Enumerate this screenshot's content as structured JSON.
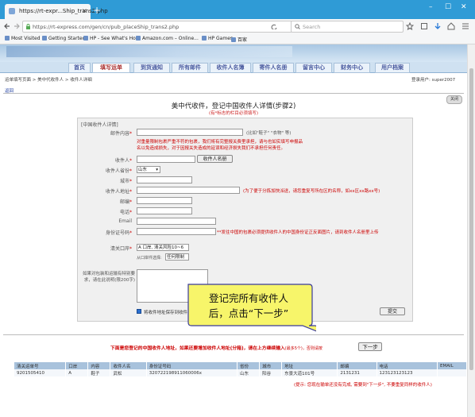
{
  "browser": {
    "tab_title": "https://rt-expr...Ship_trans2.php",
    "tab_close": "×",
    "new_tab": "+",
    "url": "https://rt-express.com/gen/cn/pub_placeShip_trans2.php",
    "search_placeholder": "Search",
    "window_controls": {
      "min": "–",
      "max": "☐",
      "close": "✕"
    },
    "bookmarks": [
      "Most Visited",
      "Getting Started",
      "HP - See What's Hot",
      "Amazon.com – Online...",
      "HP Games",
      "百家"
    ]
  },
  "menu": {
    "items": [
      "首页",
      "填写运单",
      "到货通知",
      "所有邮件",
      "收件人名簿",
      "寄件人名册",
      "留言中心",
      "财务中心",
      "用户档案"
    ],
    "active_index": 1
  },
  "crumb": "运单填写页面 > 美中代收件人 > 收件人详细",
  "user_info": "登录用户: super2007",
  "back_link": "返回",
  "close_btn": "关闭",
  "page": {
    "title": "美中代收件，登记中国收件人详情(步骤2)",
    "subtitle": "(有*标志的栏目必须填写)"
  },
  "form": {
    "section_label": "[中国收件人详情]",
    "content_label": "邮件内容",
    "content_hint": "(比如\"鞋子\" \"衣物\" 等)",
    "warning_line1": "对重量限制包裹严重不符的包裹，我们将有完整报关费里承担，请与也如实填写申报品",
    "warning_line2": "名以免造成损失，对于因报关失造成的延误和经济损失我们不承担任何责任。",
    "recipient_label": "收件人",
    "recipient_book_btn": "收件人名册",
    "province_label": "收件人省份",
    "province_value": "山东",
    "city_label": "城市",
    "address_label": "收件人地址",
    "address_hint": "(为了便于分拣加快派送，请您重复写所在区的名称，如xx区xx路xx号)",
    "zip_label": "邮编",
    "phone_label": "电话",
    "email_label": "Email",
    "id_label": "身份证号码",
    "id_note": "**发往中国的包裹必须提供收件人的中国身份证正反面图片，请到收件人名册里上传",
    "port_label": "清关口岸",
    "port_value": "A 口岸, 清关风险10~6",
    "clear_label": "从口岸件选择:",
    "clear_value": "任何限制",
    "remark_label": "如果对包装和运输有特别要求，请在此说明(限200字)",
    "save_checkbox": "将收件地址保存到收件人名册",
    "submit_btn": "提交"
  },
  "bottom": {
    "instruction": "下面是您登记的中国收件人地址，如果还要增加收件人地址(分箱)，请在上方继续输入",
    "instruction_tail": "(最多5个)，否则请按",
    "next_btn": "下一步",
    "table_headers": [
      "清关运单号",
      "口岸",
      "内容",
      "收件人名",
      "身份证号码",
      "省份",
      "城市",
      "地址",
      "邮编",
      "电话",
      "EMAIL"
    ],
    "table_row": [
      "9201505410",
      "A",
      "鞋子",
      "武松",
      "320722198911060006x",
      "山东",
      "阳谷",
      "东景大道101号",
      "2131231",
      "123123123123",
      ""
    ],
    "tip": "(提示: 您现在输单还没有完成, 需要到\"下一步\", 不要重复同样的收件人)"
  },
  "callout": {
    "line1": "登记完所有收件人",
    "line2": "后，点击“下一步”"
  },
  "colors": {
    "tabbar": "#2f9bd6",
    "menu_text": "#4a5ba0",
    "warn": "#c00000",
    "callout_fill": "#f7f56a",
    "callout_border": "#3a3a9a"
  }
}
